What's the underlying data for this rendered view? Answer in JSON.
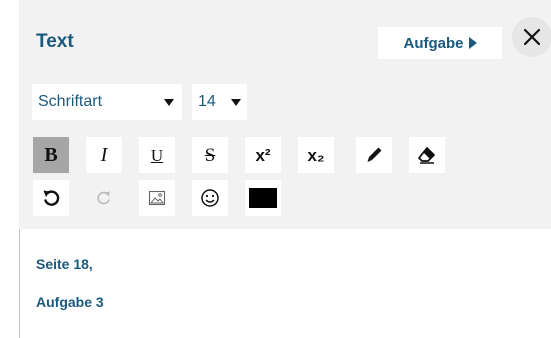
{
  "panel": {
    "title": "Text",
    "task_button_label": "Aufgabe",
    "close_icon": "close-icon"
  },
  "toolbar": {
    "font_family": {
      "value": "Schriftart"
    },
    "font_size": {
      "value": "14"
    },
    "buttons": [
      {
        "name": "bold-button",
        "glyph": "B",
        "icon": "bold-icon",
        "active": true
      },
      {
        "name": "italic-button",
        "glyph": "I",
        "icon": "italic-icon",
        "active": false
      },
      {
        "name": "underline-button",
        "glyph": "U",
        "icon": "underline-icon",
        "active": false
      },
      {
        "name": "strikethrough-button",
        "glyph": "S",
        "icon": "strikethrough-icon",
        "active": false
      },
      {
        "name": "superscript-button",
        "glyph": "x²",
        "icon": "superscript-icon",
        "active": false
      },
      {
        "name": "subscript-button",
        "glyph": "x₂",
        "icon": "subscript-icon",
        "active": false
      },
      {
        "name": "highlighter-button",
        "icon": "pen-icon",
        "active": false
      },
      {
        "name": "eraser-button",
        "icon": "eraser-icon",
        "active": false
      },
      {
        "name": "undo-button",
        "icon": "undo-icon",
        "active": false
      },
      {
        "name": "redo-button",
        "icon": "redo-icon",
        "disabled": true
      },
      {
        "name": "insert-image-button",
        "icon": "image-icon",
        "active": false
      },
      {
        "name": "emoji-button",
        "icon": "smiley-icon",
        "active": false
      },
      {
        "name": "text-color-button",
        "icon": "color-swatch-icon",
        "active": false
      }
    ]
  },
  "content": {
    "lines": [
      "Seite 18,",
      "Aufgabe 3"
    ]
  },
  "colors": {
    "accent": "#1b5a7c",
    "toolbar_bg": "#f2f2f2",
    "active_bg": "#a6a6a6",
    "swatch": "#000000"
  }
}
